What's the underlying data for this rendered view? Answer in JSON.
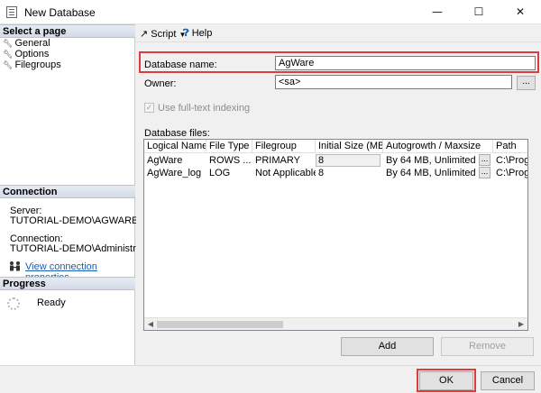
{
  "window": {
    "title": "New Database",
    "minimize": "—",
    "maximize": "☐",
    "close": "✕"
  },
  "left_panel": {
    "select_page_header": "Select a page",
    "pages": [
      "General",
      "Options",
      "Filegroups"
    ],
    "connection_header": "Connection",
    "server_label": "Server:",
    "server_value": "TUTORIAL-DEMO\\AGWARESQL",
    "connection_label": "Connection:",
    "connection_value": "TUTORIAL-DEMO\\Administrator",
    "view_connection_link": "View connection properties",
    "progress_header": "Progress",
    "progress_status": "Ready"
  },
  "toolbar": {
    "script_label": "Script",
    "help_label": "Help"
  },
  "form": {
    "database_name_label": "Database name:",
    "database_name_value": "AgWare",
    "owner_label": "Owner:",
    "owner_value": "<sa>",
    "browse_label": "...",
    "fulltext_label": "Use full-text indexing",
    "fulltext_checked": true,
    "database_files_label": "Database files:"
  },
  "grid": {
    "columns": [
      "Logical Name",
      "File Type",
      "Filegroup",
      "Initial Size (MB)",
      "Autogrowth / Maxsize",
      "Path"
    ],
    "rows": [
      {
        "logical_name": "AgWare",
        "file_type": "ROWS ...",
        "filegroup": "PRIMARY",
        "initial_size": "8",
        "autogrowth": "By 64 MB, Unlimited",
        "path": "C:\\Program"
      },
      {
        "logical_name": "AgWare_log",
        "file_type": "LOG",
        "filegroup": "Not Applicable",
        "initial_size": "8",
        "autogrowth": "By 64 MB, Unlimited",
        "path": "C:\\Program"
      }
    ]
  },
  "buttons": {
    "add": "Add",
    "remove": "Remove",
    "ok": "OK",
    "cancel": "Cancel"
  },
  "colors": {
    "highlight": "#e03a3a",
    "link": "#1a5fb4",
    "header_gradient": "#d4dbe7"
  }
}
